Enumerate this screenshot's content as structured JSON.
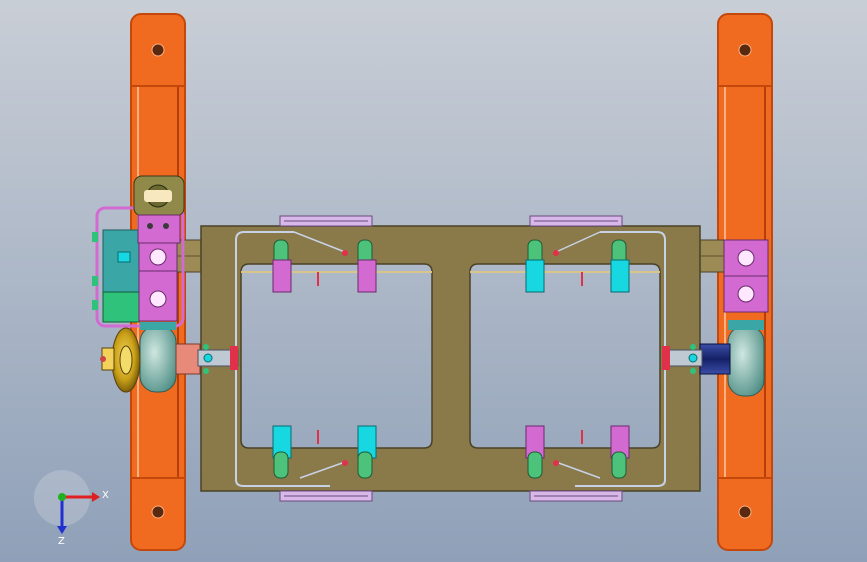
{
  "viewport": {
    "background_top": "#c9ced6",
    "background_bottom": "#8fa0b8"
  },
  "colors": {
    "rail_orange": "#f06a1f",
    "rail_edge": "#c4480c",
    "plate_olive": "#8a7a4a",
    "plate_edge": "#4b4226",
    "magenta": "#d26ad2",
    "cyan": "#17d8e0",
    "wheel_yellow": "#d6a81a",
    "motor_navy": "#1c2d7a",
    "motor_salmon": "#e88a7a",
    "green_block": "#2ec27a",
    "teal_block": "#3aa6a6",
    "wire_light": "#c8d2e6",
    "lavender": "#d8b8e8",
    "red_accent": "#e0304a",
    "slider_green": "#4cc27a"
  },
  "triad": {
    "x_label": "X",
    "z_label": "Z",
    "x_color": "#e02020",
    "y_color": "#20b020",
    "z_color": "#2030d0"
  }
}
